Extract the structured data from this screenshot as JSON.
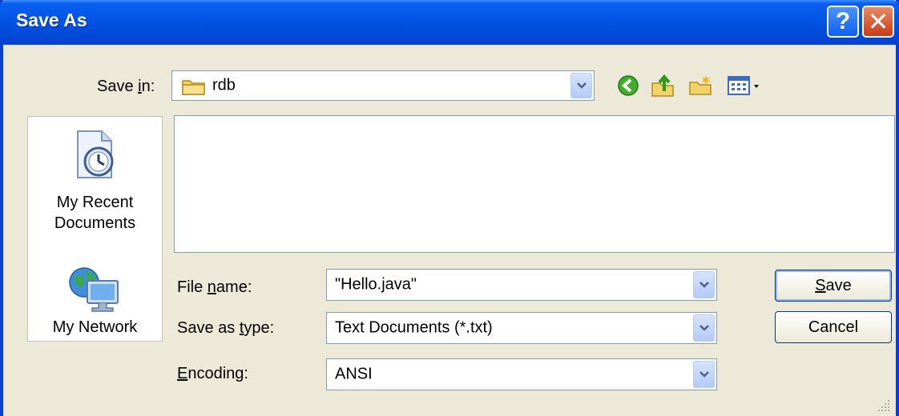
{
  "window": {
    "title": "Save As"
  },
  "titlebar": {
    "help_label": "?",
    "close_label": "✕"
  },
  "save_in": {
    "label_pre": "Save ",
    "label_key": "i",
    "label_post": "n:",
    "value": "rdb"
  },
  "places": [
    {
      "line1": "My Recent",
      "line2": "Documents",
      "icon": "recent-documents-icon"
    },
    {
      "line1": "My Network",
      "line2": "",
      "icon": "my-network-icon"
    }
  ],
  "fields": {
    "file_name": {
      "label_pre": "File ",
      "label_key": "n",
      "label_post": "ame:",
      "value": "\"Hello.java\""
    },
    "save_as_type": {
      "label_pre": "Save as ",
      "label_key": "t",
      "label_post": "ype:",
      "value": "Text Documents (*.txt)"
    },
    "encoding": {
      "label_pre": "",
      "label_key": "E",
      "label_post": "ncoding:",
      "value": "ANSI"
    }
  },
  "buttons": {
    "save": {
      "key": "S",
      "rest": "ave"
    },
    "cancel": {
      "label": "Cancel"
    }
  },
  "toolbar_icons": [
    "back-icon",
    "up-folder-icon",
    "new-folder-icon",
    "views-menu-icon"
  ],
  "colors": {
    "titlebar": "#0055e5",
    "dialog": "#ece9d8",
    "close": "#cc3a12",
    "border": "#7f9db9"
  }
}
